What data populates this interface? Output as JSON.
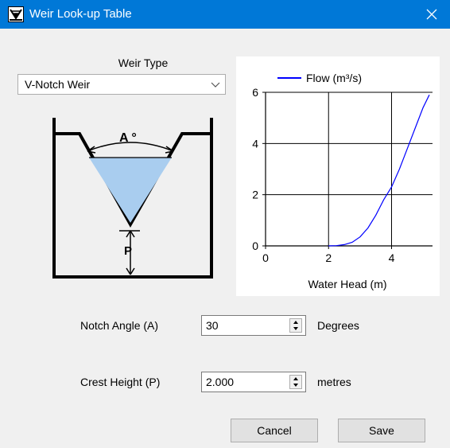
{
  "window": {
    "title": "Weir Look-up Table",
    "app_icon": "weir-app-icon",
    "close_icon": "close-icon",
    "titlebar_color": "#0078d7"
  },
  "weir_type": {
    "label": "Weir Type",
    "selected": "V-Notch Weir",
    "arrow_icon": "chevron-down-icon"
  },
  "diagram": {
    "angle_label": "A °",
    "crest_label": "P",
    "water_color": "#a9cdef"
  },
  "chart_data": {
    "type": "line",
    "title": "",
    "xlabel": "Water Head (m)",
    "ylabel": "",
    "xlim": [
      0,
      5.3
    ],
    "ylim": [
      0,
      6
    ],
    "x_ticks": [
      "0",
      "2",
      "4"
    ],
    "y_ticks": [
      "0",
      "2",
      "4",
      "6"
    ],
    "grid": true,
    "legend": "top",
    "series": [
      {
        "name": "Flow (m³/s)",
        "color": "#0000ff",
        "x": [
          2.0,
          2.25,
          2.5,
          2.75,
          3.0,
          3.25,
          3.5,
          3.75,
          4.0,
          4.25,
          4.5,
          4.75,
          5.0,
          5.2
        ],
        "y": [
          0.0,
          0.01,
          0.05,
          0.14,
          0.35,
          0.7,
          1.2,
          1.8,
          2.3,
          3.0,
          3.8,
          4.6,
          5.4,
          5.9
        ]
      }
    ]
  },
  "notch_angle": {
    "label": "Notch Angle (A)",
    "value": "30",
    "unit": "Degrees"
  },
  "crest_height": {
    "label": "Crest Height (P)",
    "value": "2.000",
    "unit": "metres"
  },
  "buttons": {
    "cancel": "Cancel",
    "save": "Save"
  }
}
